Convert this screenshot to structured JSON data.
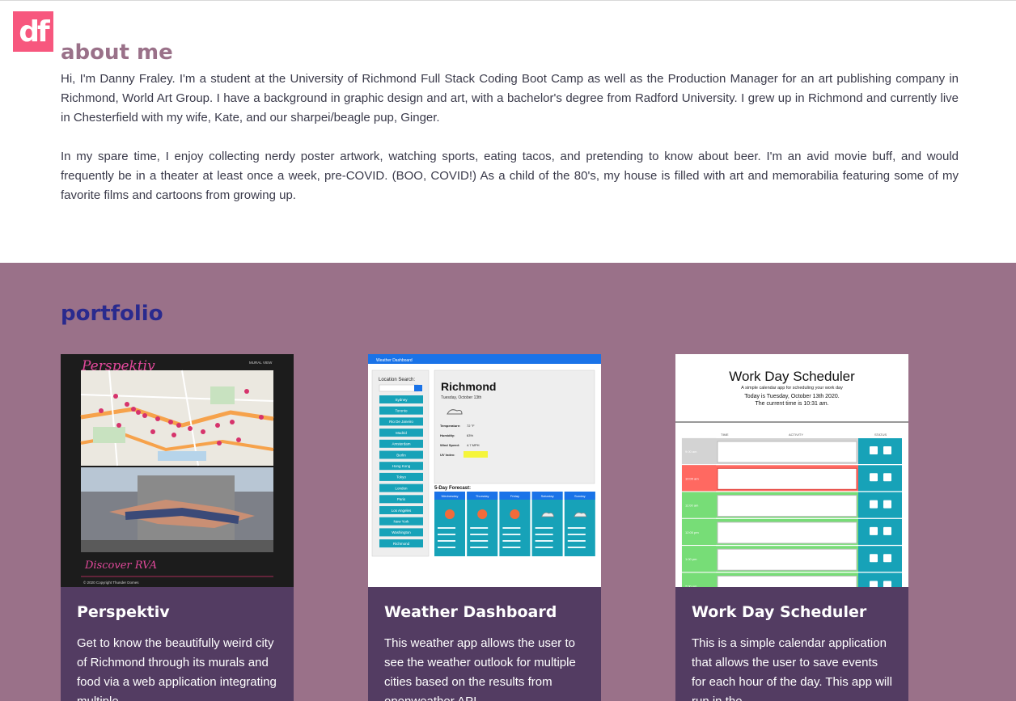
{
  "logo": {
    "text": "df",
    "color": "#f7577e"
  },
  "about": {
    "heading": "about me",
    "para1": "Hi, I'm Danny Fraley. I'm a student at the University of Richmond Full Stack Coding Boot Camp as well as the Production Manager for an art publishing company in Richmond, World Art Group. I have a background in graphic design and art, with a bachelor's degree from Radford University. I grew up in Richmond and currently live in Chesterfield with my wife, Kate, and our sharpei/beagle pup, Ginger.",
    "para2": "In my spare time, I enjoy collecting nerdy poster artwork, watching sports, eating tacos, and pretending to know about beer. I'm an avid movie buff, and would frequently be in a theater at least once a week, pre-COVID. (BOO, COVID!) As a child of the 80's, my house is filled with art and memorabilia featuring some of my favorite films and cartoons from growing up."
  },
  "portfolio": {
    "heading": "portfolio",
    "bg_color": "#9a7189",
    "card_color": "#533c62",
    "cards": [
      {
        "title": "Perspektiv",
        "desc": "Get to know the beautifully weird city of Richmond through its murals and food via a web application integrating multiple",
        "shot": {
          "brand": "Perspektiv",
          "subtitle": "MURAL VIEW",
          "footer_brand": "Discover RVA",
          "copyright": "© 2020 Copyright Thunder Domes"
        }
      },
      {
        "title": "Weather Dashboard",
        "desc": "This weather app allows the user to see the weather outlook for multiple cities based on the results from openweather API",
        "shot": {
          "bar": "Weather Dashboard",
          "search_label": "Location Search:",
          "cities": [
            "Sydney",
            "Toronto",
            "Rio De Janeiro",
            "Madrid",
            "Amsterdam",
            "Berlin",
            "Hong Kong",
            "Tokyo",
            "London",
            "Paris",
            "Los Angeles",
            "New York",
            "Washington",
            "Richmond"
          ],
          "city": "Richmond",
          "date": "Tuesday, October 13th",
          "stats": [
            "Temperature:",
            "Humidity:",
            "Wind Speed:",
            "UV Index:"
          ],
          "stat_vals": [
            "72 °F",
            "63%",
            "4.7 MPH",
            "4.63"
          ],
          "forecast_title": "5-Day Forecast:",
          "days": [
            "Wednesday",
            "Thursday",
            "Friday",
            "Saturday",
            "Sunday"
          ]
        }
      },
      {
        "title": "Work Day Scheduler",
        "desc": "This is a simple calendar application that allows the user to save events for each hour of the day. This app will run in the",
        "shot": {
          "title": "Work Day Scheduler",
          "sub1": "A simple calendar app for scheduling your work day",
          "sub2": "Today is Tuesday, October 13th 2020.",
          "sub3": "The current time is 10:31 am.",
          "cols": [
            "TIME",
            "ACTIVITY",
            "STATUS"
          ],
          "hours": [
            "9:00 am",
            "10:00 am",
            "11:00 am",
            "12:00 pm",
            "1:00 pm",
            "2:00 pm"
          ]
        }
      }
    ]
  }
}
